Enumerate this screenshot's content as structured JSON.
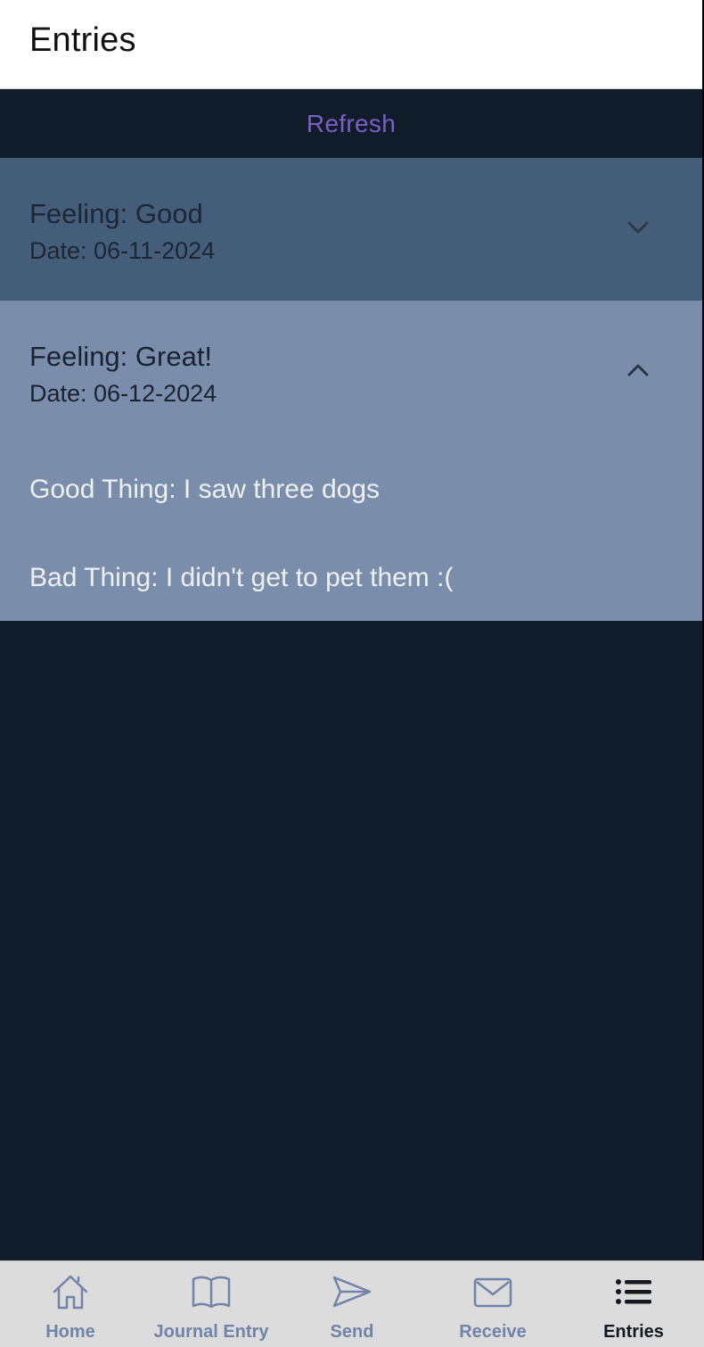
{
  "header": {
    "title": "Entries"
  },
  "toolbar": {
    "refresh_label": "Refresh"
  },
  "entries": [
    {
      "feeling": "Feeling: Good",
      "date": "Date: 06-11-2024",
      "expanded": false
    },
    {
      "feeling": "Feeling: Great!",
      "date": "Date: 06-12-2024",
      "expanded": true,
      "good_thing": "Good Thing: I saw three dogs",
      "bad_thing": "Bad Thing: I didn't get to pet them :("
    }
  ],
  "tabs": [
    {
      "label": "Home",
      "icon": "home-icon",
      "active": false
    },
    {
      "label": "Journal Entry",
      "icon": "book-icon",
      "active": false
    },
    {
      "label": "Send",
      "icon": "send-icon",
      "active": false
    },
    {
      "label": "Receive",
      "icon": "mail-icon",
      "active": false
    },
    {
      "label": "Entries",
      "icon": "list-icon",
      "active": true
    }
  ],
  "colors": {
    "background": "#111c2b",
    "entry_collapsed": "#445d79",
    "entry_expanded": "#7a8eab",
    "accent": "#7b5fc2",
    "tab_inactive": "#6f84a8",
    "tab_active": "#14191f"
  }
}
